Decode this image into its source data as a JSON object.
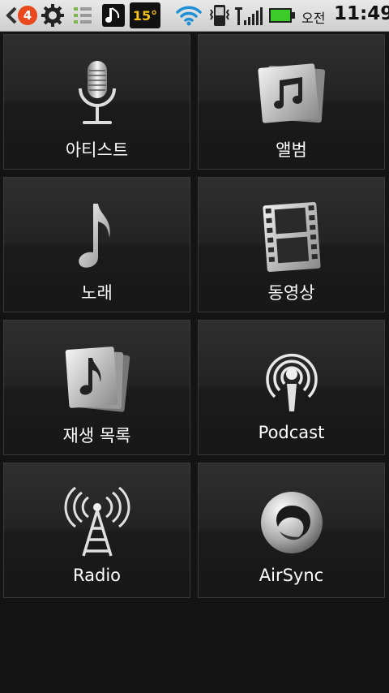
{
  "status_bar": {
    "notification_count": "4",
    "temperature": "15°",
    "am_pm": "오전",
    "time": "11:49"
  },
  "menu": {
    "items": [
      {
        "label": "아티스트",
        "icon": "microphone-icon"
      },
      {
        "label": "앨범",
        "icon": "album-icon"
      },
      {
        "label": "노래",
        "icon": "music-note-icon"
      },
      {
        "label": "동영상",
        "icon": "film-strip-icon"
      },
      {
        "label": "재생 목록",
        "icon": "playlist-icon"
      },
      {
        "label": "Podcast",
        "icon": "podcast-icon"
      },
      {
        "label": "Radio",
        "icon": "radio-tower-icon"
      },
      {
        "label": "AirSync",
        "icon": "airsync-icon"
      }
    ]
  }
}
